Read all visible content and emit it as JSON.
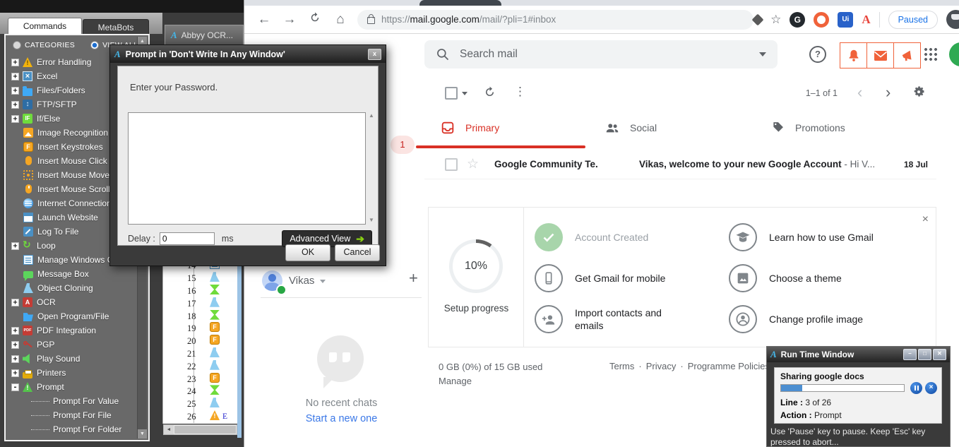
{
  "automation": {
    "tabs": {
      "commands": "Commands",
      "metabots": "MetaBots"
    },
    "radios": {
      "categories": "CATEGORIES",
      "view_all": "VIEW ALL"
    },
    "taskbar_tab": "Abbyy OCR...",
    "tree": [
      {
        "exp": "+",
        "icon": "warn-y",
        "label": "Error Handling"
      },
      {
        "exp": "+",
        "icon": "excel",
        "label": "Excel"
      },
      {
        "exp": "+",
        "icon": "folder",
        "label": "Files/Folders"
      },
      {
        "exp": "+",
        "icon": "ftp",
        "label": "FTP/SFTP"
      },
      {
        "exp": "+",
        "icon": "ifelse",
        "label": "If/Else"
      },
      {
        "icon": "imgrec",
        "label": "Image Recognition",
        "cls": "noexp"
      },
      {
        "icon": "fkey",
        "label": "Insert Keystrokes",
        "cls": "noexp"
      },
      {
        "icon": "mouse",
        "label": "Insert Mouse Click",
        "cls": "noexp"
      },
      {
        "icon": "mousemove",
        "label": "Insert Mouse Move",
        "cls": "noexp"
      },
      {
        "icon": "mousescroll",
        "label": "Insert Mouse Scroll",
        "cls": "noexp"
      },
      {
        "icon": "globe",
        "label": "Internet Connection",
        "cls": "noexp"
      },
      {
        "icon": "website",
        "label": "Launch Website",
        "cls": "noexp"
      },
      {
        "icon": "logfile",
        "label": "Log To File",
        "cls": "noexp"
      },
      {
        "exp": "+",
        "icon": "loop",
        "label": "Loop"
      },
      {
        "icon": "managewin",
        "label": "Manage Windows C",
        "cls": "noexp"
      },
      {
        "icon": "msgbox",
        "label": "Message Box",
        "cls": "noexp"
      },
      {
        "icon": "flask",
        "label": "Object Cloning",
        "cls": "noexp"
      },
      {
        "exp": "+",
        "icon": "ocr",
        "label": "OCR"
      },
      {
        "icon": "openprog",
        "label": "Open Program/File",
        "cls": "noexp"
      },
      {
        "exp": "+",
        "icon": "pdf",
        "label": "PDF Integration"
      },
      {
        "exp": "+",
        "icon": "pgp",
        "label": "PGP"
      },
      {
        "exp": "+",
        "icon": "sound",
        "label": "Play Sound"
      },
      {
        "exp": "+",
        "icon": "printer",
        "label": "Printers"
      },
      {
        "exp": "-",
        "icon": "prompt",
        "label": "Prompt"
      },
      {
        "label": "Prompt For Value",
        "cls": "child"
      },
      {
        "label": "Prompt For File",
        "cls": "child"
      },
      {
        "label": "Prompt For Folder",
        "cls": "child"
      }
    ],
    "task_lines": [
      {
        "num": "14",
        "icon": "doc"
      },
      {
        "num": "15",
        "icon": "flask"
      },
      {
        "num": "16",
        "icon": "hour"
      },
      {
        "num": "17",
        "icon": "flask"
      },
      {
        "num": "18",
        "icon": "hour"
      },
      {
        "num": "19",
        "icon": "fkey"
      },
      {
        "num": "20",
        "icon": "fkey"
      },
      {
        "num": "21",
        "icon": "flask"
      },
      {
        "num": "22",
        "icon": "flask"
      },
      {
        "num": "23",
        "icon": "fkey"
      },
      {
        "num": "24",
        "icon": "hour"
      },
      {
        "num": "25",
        "icon": "flask"
      },
      {
        "num": "26",
        "icon": "warn",
        "text": "E"
      }
    ]
  },
  "dialog": {
    "title": "Prompt in 'Don't Write In Any Window'",
    "message": "Enter your Password.",
    "close": "x",
    "delay_label": "Delay :",
    "delay_value": "0",
    "delay_unit": "ms",
    "advanced_view": "Advanced View",
    "ok": "OK",
    "cancel": "Cancel"
  },
  "browser": {
    "url_scheme": "https://",
    "url_host": "mail.google.com",
    "url_path": "/mail/?pli=1#inbox",
    "paused": "Paused"
  },
  "gmail": {
    "search_placeholder": "Search mail",
    "toolbar_range": "1–1 of 1",
    "primary_badge": "1",
    "tabs": [
      {
        "label": "Primary"
      },
      {
        "label": "Social"
      },
      {
        "label": "Promotions"
      }
    ],
    "email": {
      "sender": "Google Community Te.",
      "subject": "Vikas, welcome to your new Google Account",
      "snippet": " - Hi V...",
      "date": "18 Jul"
    },
    "setup": {
      "percent": "10%",
      "caption": "Setup progress",
      "items": [
        {
          "icon": "done",
          "label": "Account Created",
          "cls": "done"
        },
        {
          "icon": "mobile",
          "label": "Get Gmail for mobile"
        },
        {
          "icon": "import",
          "label": "Import contacts and emails"
        },
        {
          "icon": "learn",
          "label": "Learn how to use Gmail"
        },
        {
          "icon": "theme",
          "label": "Choose a theme"
        },
        {
          "icon": "profile",
          "label": "Change profile image"
        }
      ]
    },
    "storage": "0 GB (0%) of 15 GB used",
    "manage": "Manage",
    "footer_links": [
      "Terms",
      "Privacy",
      "Programme Policies"
    ],
    "hangouts": {
      "user": "Vikas",
      "empty": "No recent chats",
      "cta": "Start a new one"
    }
  },
  "runtime": {
    "title": "Run Time Window",
    "task": "Sharing google docs",
    "line_label": "Line :",
    "line_value": "3 of 26",
    "action_label": "Action :",
    "action_value": "Prompt",
    "hint": "Use 'Pause' key to pause. Keep 'Esc' key pressed to abort..."
  }
}
